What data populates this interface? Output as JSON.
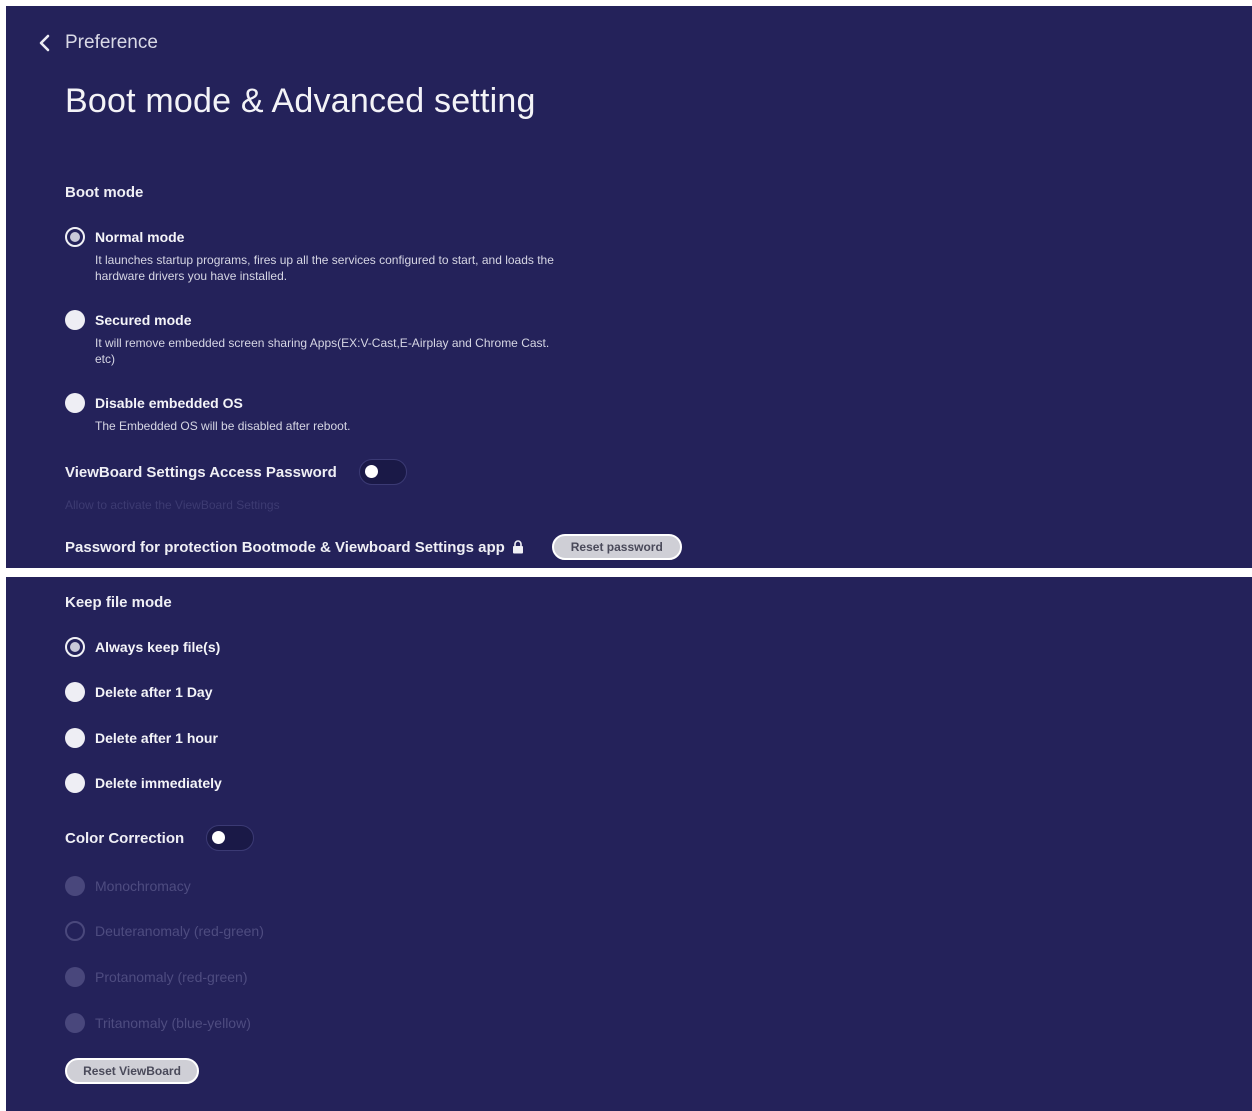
{
  "header": {
    "back_label": "Preference",
    "title": "Boot mode & Advanced setting"
  },
  "boot_mode": {
    "section_title": "Boot mode",
    "options": [
      {
        "label": "Normal mode",
        "description": "It launches startup programs, fires up all the services configured to start, and loads the hardware drivers you have installed.",
        "selected": true
      },
      {
        "label": "Secured mode",
        "description": "It will remove embedded screen sharing Apps(EX:V-Cast,E-Airplay and Chrome Cast. etc)",
        "selected": false
      },
      {
        "label": "Disable embedded OS",
        "description": "The Embedded OS will be disabled after reboot.",
        "selected": false
      }
    ]
  },
  "access_password": {
    "label": "ViewBoard Settings Access Password",
    "enabled": false,
    "hint": "Allow to activate the ViewBoard Settings"
  },
  "password_protection": {
    "label": "Password for protection Bootmode & Viewboard Settings app",
    "reset_button": "Reset password"
  },
  "keep_file_mode": {
    "section_title": "Keep file mode",
    "options": [
      {
        "label": "Always keep file(s)",
        "selected": true
      },
      {
        "label": "Delete after 1 Day",
        "selected": false
      },
      {
        "label": "Delete after 1 hour",
        "selected": false
      },
      {
        "label": "Delete immediately",
        "selected": false
      }
    ]
  },
  "color_correction": {
    "label": "Color Correction",
    "enabled": false,
    "options": [
      {
        "label": "Monochromacy"
      },
      {
        "label": "Deuteranomaly (red-green)"
      },
      {
        "label": "Protanomaly (red-green)"
      },
      {
        "label": "Tritanomaly (blue-yellow)"
      }
    ]
  },
  "reset_viewboard_button": "Reset ViewBoard",
  "colors": {
    "background": "#24225a",
    "text": "#f2f2f6",
    "disabled_text": "#4e4c80"
  }
}
